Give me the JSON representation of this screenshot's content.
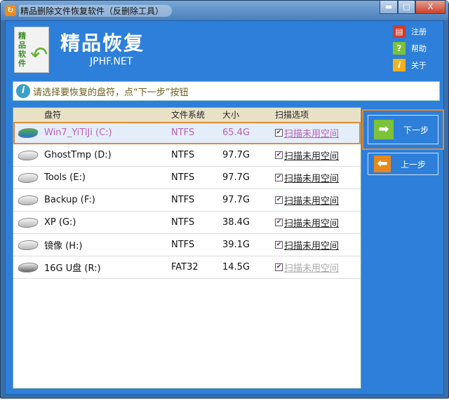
{
  "window": {
    "title": "精品删除文件恢复软件（反删除工具）",
    "minimize": "▬",
    "maximize": "□",
    "close": "X"
  },
  "header": {
    "app_name": "精品恢复",
    "site": "JPHF.NET",
    "logo_text": "精品软件"
  },
  "links": [
    {
      "label": "注册",
      "icon": "cart-icon",
      "color": "#d23a2a"
    },
    {
      "label": "帮助",
      "icon": "help-icon",
      "color": "#7cc23a"
    },
    {
      "label": "关于",
      "icon": "info-icon",
      "color": "#f0b020"
    }
  ],
  "info": {
    "message": "请选择要恢复的盘符，点“下一步”按钮"
  },
  "table": {
    "columns": [
      "盘符",
      "文件系统",
      "大小",
      "扫描选项"
    ],
    "rows": [
      {
        "name": "Win7_YiTiJi (C:)",
        "fs": "NTFS",
        "size": "65.4G",
        "scan": "扫描未用空间",
        "checked": true,
        "selected": true,
        "type": "sys"
      },
      {
        "name": "GhostTmp (D:)",
        "fs": "NTFS",
        "size": "97.7G",
        "scan": "扫描未用空间",
        "checked": true,
        "type": "hdd"
      },
      {
        "name": "Tools (E:)",
        "fs": "NTFS",
        "size": "97.7G",
        "scan": "扫描未用空间",
        "checked": true,
        "type": "hdd"
      },
      {
        "name": "Backup (F:)",
        "fs": "NTFS",
        "size": "97.7G",
        "scan": "扫描未用空间",
        "checked": true,
        "type": "hdd"
      },
      {
        "name": "XP (G:)",
        "fs": "NTFS",
        "size": "38.4G",
        "scan": "扫描未用空间",
        "checked": true,
        "type": "hdd"
      },
      {
        "name": "镜像 (H:)",
        "fs": "NTFS",
        "size": "39.1G",
        "scan": "扫描未用空间",
        "checked": true,
        "type": "hdd"
      },
      {
        "name": "16G U盘 (R:)",
        "fs": "FAT32",
        "size": "14.5G",
        "scan": "扫描未用空间",
        "checked": true,
        "disabled": true,
        "type": "usb"
      }
    ]
  },
  "buttons": {
    "next": "下一步",
    "prev": "上一步"
  }
}
